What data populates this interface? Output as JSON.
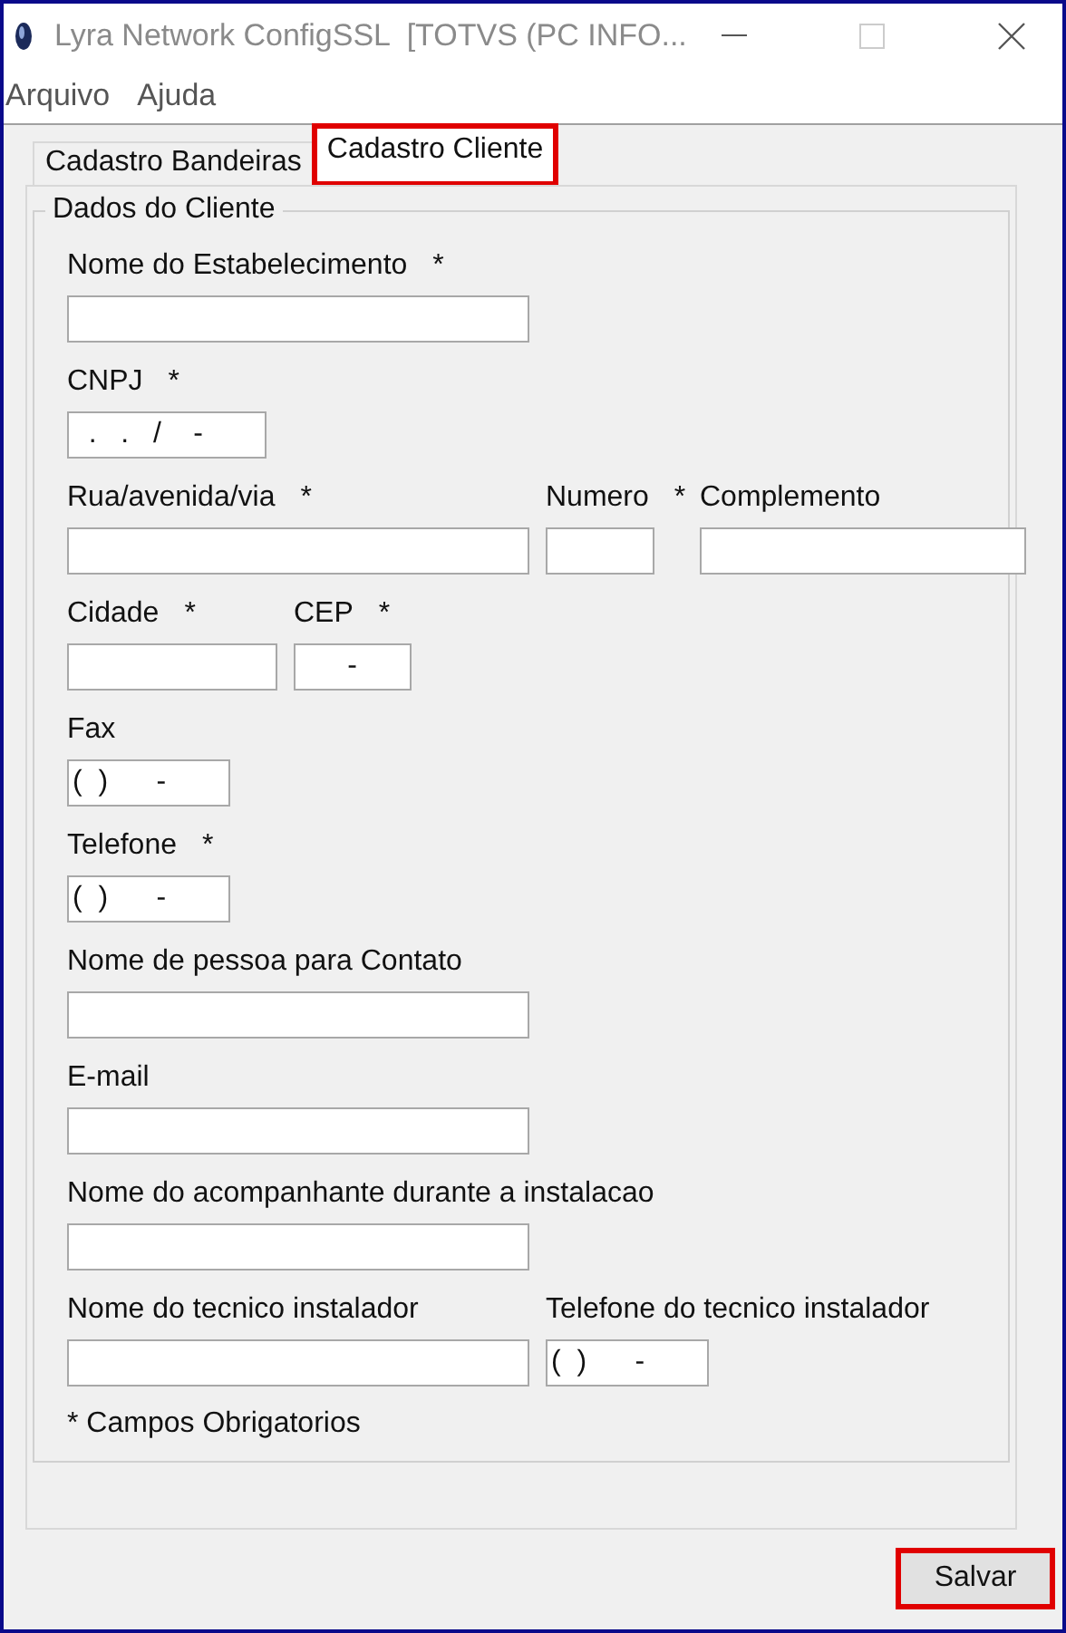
{
  "window": {
    "title": "Lyra Network ConfigSSL  [TOTVS (PC INFO...",
    "maximize_disabled": true
  },
  "menu": [
    "Arquivo",
    "Ajuda"
  ],
  "tabs": [
    {
      "label": "Cadastro Bandeiras",
      "selected": false,
      "highlighted": false
    },
    {
      "label": "Cadastro Cliente",
      "selected": true,
      "highlighted": true
    }
  ],
  "group": {
    "title": "Dados do Cliente",
    "rows": [
      [
        {
          "label": "Nome do Estabelecimento",
          "required_mark": "*"
        }
      ],
      [
        {
          "label": "CNPJ",
          "required_mark": "*",
          "value": "  .   .   /    -"
        }
      ],
      [
        {
          "label": "Rua/avenida/via",
          "required_mark": "*"
        },
        {
          "label": "Numero",
          "required_mark": "*"
        },
        {
          "label": "Complemento"
        }
      ],
      [
        {
          "label": "Cidade",
          "required_mark": "*"
        },
        {
          "label": "CEP",
          "required_mark": "*",
          "value": "      -"
        }
      ],
      [
        {
          "label": "Fax",
          "value": "(  )      -"
        }
      ],
      [
        {
          "label": "Telefone",
          "required_mark": "*",
          "value": "(  )      -"
        }
      ],
      [
        {
          "label": "Nome de pessoa para Contato"
        }
      ],
      [
        {
          "label": "E-mail"
        }
      ],
      [
        {
          "label": "Nome do acompanhante durante a instalacao"
        }
      ],
      [
        {
          "label": "Nome do tecnico instalador"
        },
        {
          "label": "Telefone do tecnico instalador",
          "value": "(  )      -"
        }
      ]
    ],
    "note": "* Campos Obrigatorios"
  },
  "save_button": {
    "label": "Salvar",
    "highlighted": true
  }
}
